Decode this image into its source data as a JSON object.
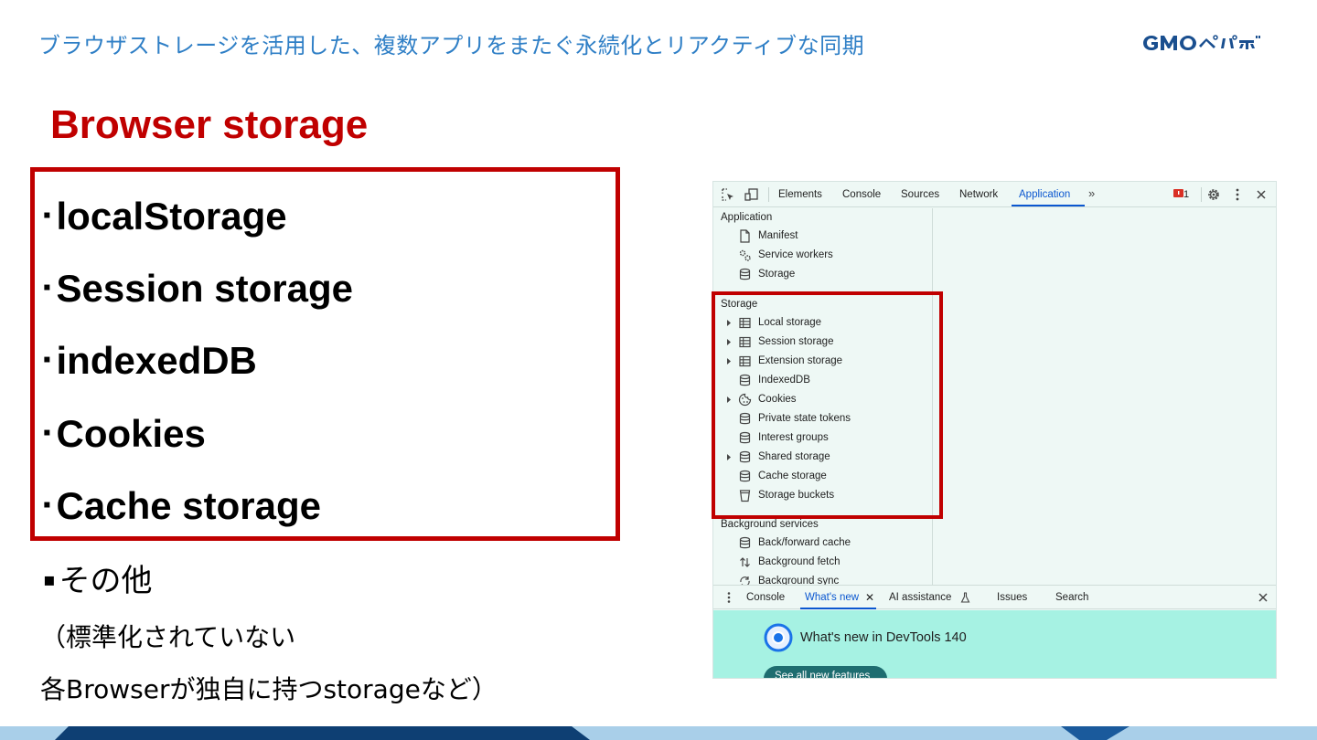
{
  "header": {
    "title": "ブラウザストレージを活用した、複数アプリをまたぐ永続化とリアクティブな同期",
    "logo": "GMOペパボ"
  },
  "slide": {
    "title": "Browser storage",
    "bullet_marker": "▪",
    "boxed_items": [
      "localStorage",
      "Session storage",
      "indexedDB",
      "Cookies",
      "Cache storage"
    ],
    "other_item": "その他",
    "note_line1": "（標準化されていない",
    "note_line2": "各Browserが独自に持つstorageなど）"
  },
  "devtools": {
    "tabs": [
      {
        "label": "Elements",
        "active": false
      },
      {
        "label": "Console",
        "active": false
      },
      {
        "label": "Sources",
        "active": false
      },
      {
        "label": "Network",
        "active": false
      },
      {
        "label": "Application",
        "active": true
      }
    ],
    "error_count": "1",
    "sidebar": {
      "application": {
        "heading": "Application",
        "items": [
          {
            "label": "Manifest",
            "icon": "document-icon"
          },
          {
            "label": "Service workers",
            "icon": "gears-icon"
          },
          {
            "label": "Storage",
            "icon": "database-icon"
          }
        ]
      },
      "storage": {
        "heading": "Storage",
        "items": [
          {
            "label": "Local storage",
            "icon": "table-icon",
            "expandable": true
          },
          {
            "label": "Session storage",
            "icon": "table-icon",
            "expandable": true
          },
          {
            "label": "Extension storage",
            "icon": "table-icon",
            "expandable": true
          },
          {
            "label": "IndexedDB",
            "icon": "database-icon",
            "expandable": false
          },
          {
            "label": "Cookies",
            "icon": "cookie-icon",
            "expandable": true
          },
          {
            "label": "Private state tokens",
            "icon": "database-icon",
            "expandable": false
          },
          {
            "label": "Interest groups",
            "icon": "database-icon",
            "expandable": false
          },
          {
            "label": "Shared storage",
            "icon": "database-icon",
            "expandable": true
          },
          {
            "label": "Cache storage",
            "icon": "database-icon",
            "expandable": false
          },
          {
            "label": "Storage buckets",
            "icon": "bucket-icon",
            "expandable": false
          }
        ]
      },
      "background": {
        "heading": "Background services",
        "items": [
          {
            "label": "Back/forward cache",
            "icon": "database-icon"
          },
          {
            "label": "Background fetch",
            "icon": "fetch-arrows-icon"
          },
          {
            "label": "Background sync",
            "icon": "sync-icon"
          }
        ]
      }
    },
    "drawer": {
      "tabs": [
        {
          "label": "Console",
          "active": false
        },
        {
          "label": "What's new",
          "active": true
        },
        {
          "label": "AI assistance",
          "active": false
        },
        {
          "label": "Issues",
          "active": false
        },
        {
          "label": "Search",
          "active": false
        }
      ],
      "whats_new_title": "What's new in DevTools 140",
      "whats_new_button": "See all new features"
    }
  },
  "colors": {
    "accent_red": "#c00000",
    "header_blue": "#2f7fc6",
    "devtools_bg": "#eef8f5",
    "devtools_active": "#0b57d0",
    "whats_new_bg": "#a6f2e3",
    "footer_dark": "#0e3f73",
    "footer_light": "#a9cfe9"
  }
}
